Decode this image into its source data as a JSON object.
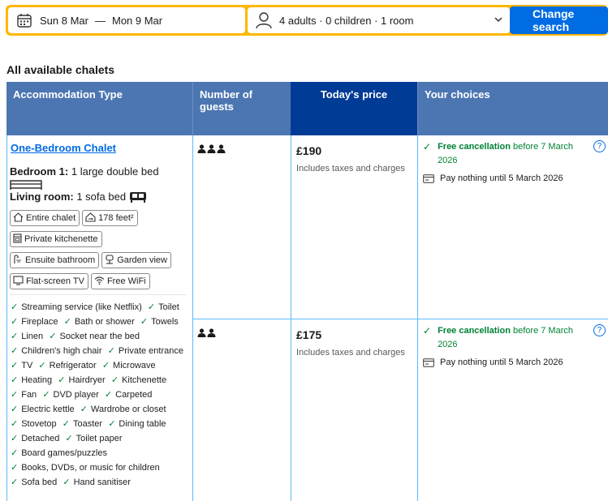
{
  "search": {
    "checkin": "Sun 8 Mar",
    "separator": "—",
    "checkout": "Mon 9 Mar",
    "guests": "4 adults · 0 children · 1 room",
    "button": "Change search"
  },
  "section_title": "All available chalets",
  "columns": {
    "type": "Accommodation Type",
    "guests": "Number of guests",
    "price": "Today's price",
    "choices": "Your choices"
  },
  "room": {
    "name": "One-Bedroom Chalet",
    "bedroom_label": "Bedroom 1:",
    "bedroom_value": "1 large double bed",
    "living_label": "Living room:",
    "living_value": "1 sofa bed",
    "chips": [
      {
        "label": "Entire chalet",
        "icon": "home-icon"
      },
      {
        "label": "178 feet²",
        "icon": "size-icon"
      },
      {
        "label": "Private kitchenette",
        "icon": "kitchen-icon"
      },
      {
        "label": "Ensuite bathroom",
        "icon": "shower-icon"
      },
      {
        "label": "Garden view",
        "icon": "tree-icon"
      },
      {
        "label": "Flat-screen TV",
        "icon": "tv-icon"
      },
      {
        "label": "Free WiFi",
        "icon": "wifi-icon"
      }
    ],
    "facilities": [
      "Streaming service (like Netflix)",
      "Toilet",
      "Fireplace",
      "Bath or shower",
      "Towels",
      "Linen",
      "Socket near the bed",
      "Children's high chair",
      "Private entrance",
      "TV",
      "Refrigerator",
      "Microwave",
      "Heating",
      "Hairdryer",
      "Kitchenette",
      "Fan",
      "DVD player",
      "Carpeted",
      "Electric kettle",
      "Wardrobe or closet",
      "Stovetop",
      "Toaster",
      "Dining table",
      "Detached",
      "Toilet paper",
      "Board games/puzzles",
      "Books, DVDs, or music for children",
      "Sofa bed",
      "Hand sanitiser"
    ]
  },
  "options": [
    {
      "guests": 3,
      "price": "£190",
      "taxes": "Includes taxes and charges",
      "free_cancel": "Free cancellation",
      "free_cancel_suffix": " before 7 March",
      "free_cancel_year": "2026",
      "pay": "Pay nothing until 5 March 2026"
    },
    {
      "guests": 2,
      "price": "£175",
      "taxes": "Includes taxes and charges",
      "free_cancel": "Free cancellation",
      "free_cancel_suffix": " before 7 March",
      "free_cancel_year": "2026",
      "pay": "Pay nothing until 5 March 2026"
    }
  ],
  "colors": {
    "accent": "#006ce4",
    "header": "#4c76b2",
    "header_dark": "#003b95",
    "searchbar": "#ffb700",
    "success": "#008234"
  }
}
